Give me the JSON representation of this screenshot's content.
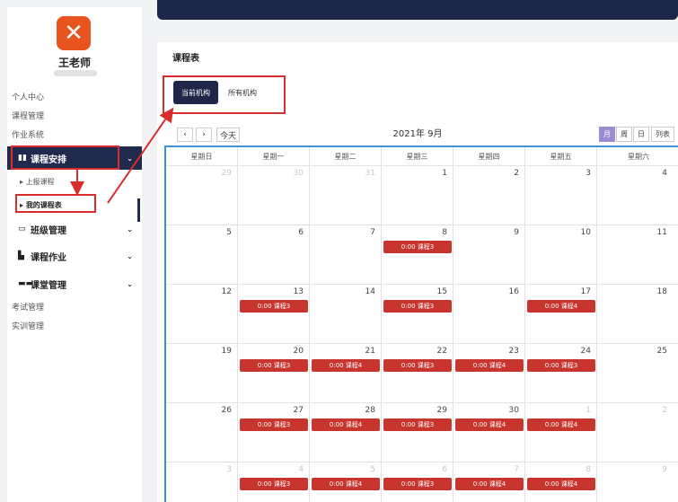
{
  "sidebar": {
    "username": "王老师",
    "plain_top": [
      "个人中心",
      "课程管理",
      "作业系统"
    ],
    "groups": [
      {
        "icon": "▮▮",
        "label": "课程安排",
        "chev": "⌄"
      },
      {
        "icon": "▭",
        "label": "班级管理",
        "chev": "⌄"
      },
      {
        "icon": "▙",
        "label": "课程作业",
        "chev": "⌄"
      },
      {
        "icon": "▬▬",
        "label": "课堂管理",
        "chev": "⌄"
      }
    ],
    "sub_items": [
      "上报课程",
      "我的课程表"
    ],
    "plain_bottom": [
      "考试管理",
      "实训管理"
    ]
  },
  "card": {
    "title": "课程表",
    "org_tabs": [
      "当前机构",
      "所有机构"
    ]
  },
  "calendar": {
    "prev": "‹",
    "next": "›",
    "today": "今天",
    "month_title": "2021年 9月",
    "views": [
      "月",
      "周",
      "日",
      "列表"
    ],
    "active_view": "月",
    "weekdays": [
      "星期日",
      "星期一",
      "星期二",
      "星期三",
      "星期四",
      "星期五",
      "星期六"
    ],
    "weeks": [
      [
        {
          "day": "29",
          "other": true,
          "event": ""
        },
        {
          "day": "30",
          "other": true,
          "event": ""
        },
        {
          "day": "31",
          "other": true,
          "event": ""
        },
        {
          "day": "1",
          "other": false,
          "event": ""
        },
        {
          "day": "2",
          "other": false,
          "event": ""
        },
        {
          "day": "3",
          "other": false,
          "event": ""
        },
        {
          "day": "4",
          "other": false,
          "event": ""
        }
      ],
      [
        {
          "day": "5",
          "other": false,
          "event": ""
        },
        {
          "day": "6",
          "other": false,
          "event": ""
        },
        {
          "day": "7",
          "other": false,
          "event": ""
        },
        {
          "day": "8",
          "other": false,
          "event": "0:00 课程3"
        },
        {
          "day": "9",
          "other": false,
          "event": ""
        },
        {
          "day": "10",
          "other": false,
          "event": ""
        },
        {
          "day": "11",
          "other": false,
          "event": ""
        }
      ],
      [
        {
          "day": "12",
          "other": false,
          "event": ""
        },
        {
          "day": "13",
          "other": false,
          "event": "0:00 课程3"
        },
        {
          "day": "14",
          "other": false,
          "event": ""
        },
        {
          "day": "15",
          "other": false,
          "event": "0:00 课程3"
        },
        {
          "day": "16",
          "other": false,
          "event": ""
        },
        {
          "day": "17",
          "other": false,
          "event": "0:00 课程4"
        },
        {
          "day": "18",
          "other": false,
          "event": ""
        }
      ],
      [
        {
          "day": "19",
          "other": false,
          "event": ""
        },
        {
          "day": "20",
          "other": false,
          "event": "0:00 课程3"
        },
        {
          "day": "21",
          "other": false,
          "event": "0:00 课程4"
        },
        {
          "day": "22",
          "other": false,
          "event": "0:00 课程3"
        },
        {
          "day": "23",
          "other": false,
          "event": "0:00 课程4"
        },
        {
          "day": "24",
          "other": false,
          "event": "0:00 课程3"
        },
        {
          "day": "25",
          "other": false,
          "event": ""
        }
      ],
      [
        {
          "day": "26",
          "other": false,
          "event": ""
        },
        {
          "day": "27",
          "other": false,
          "event": "0:00 课程3"
        },
        {
          "day": "28",
          "other": false,
          "event": "0:00 课程4"
        },
        {
          "day": "29",
          "other": false,
          "event": "0:00 课程3"
        },
        {
          "day": "30",
          "other": false,
          "event": "0:00 课程4"
        },
        {
          "day": "1",
          "other": true,
          "event": "0:00 课程4"
        },
        {
          "day": "2",
          "other": true,
          "event": ""
        }
      ],
      [
        {
          "day": "3",
          "other": true,
          "event": ""
        },
        {
          "day": "4",
          "other": true,
          "event": "0:00 课程3"
        },
        {
          "day": "5",
          "other": true,
          "event": "0:00 课程4"
        },
        {
          "day": "6",
          "other": true,
          "event": "0:00 课程3"
        },
        {
          "day": "7",
          "other": true,
          "event": "0:00 课程4"
        },
        {
          "day": "8",
          "other": true,
          "event": "0:00 课程4"
        },
        {
          "day": "9",
          "other": true,
          "event": ""
        }
      ]
    ]
  },
  "colors": {
    "nav_dark": "#1e2749",
    "event_red": "#c8352e",
    "annotation_red": "#d62d2d",
    "calendar_border": "#3f8fd8",
    "active_view": "#9b8bd0",
    "logo": "#e8541e"
  }
}
